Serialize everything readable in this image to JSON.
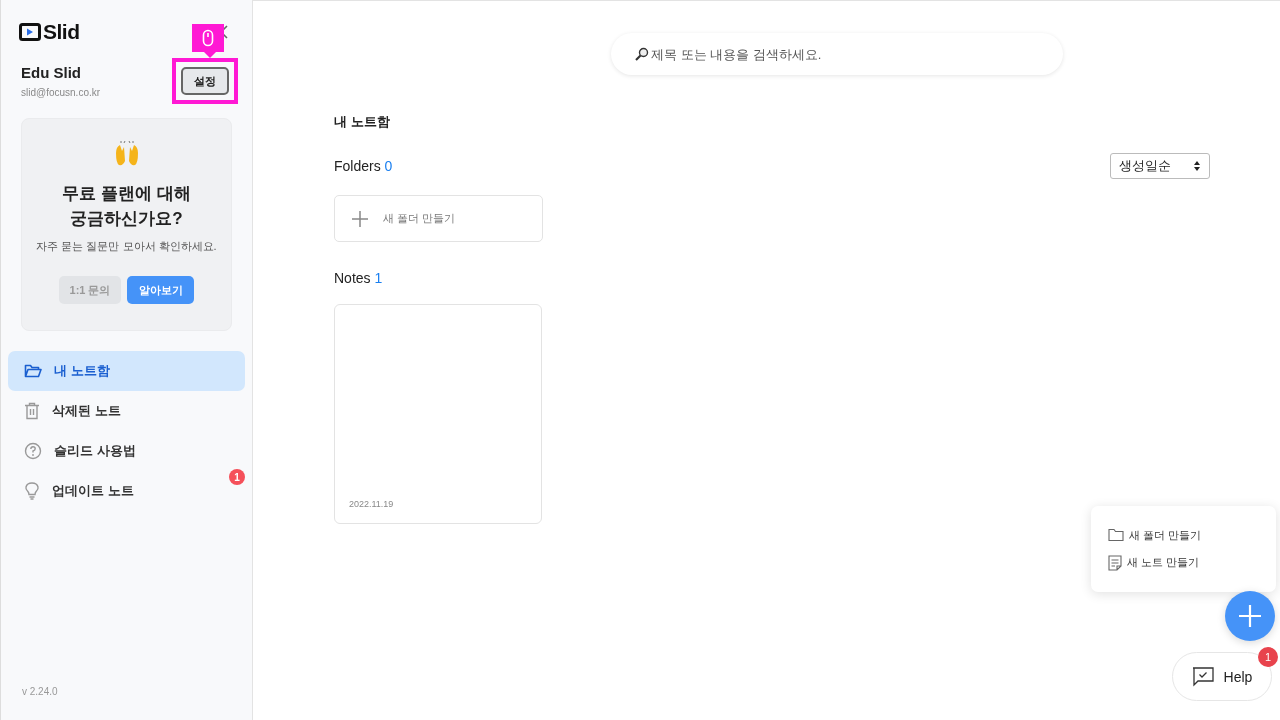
{
  "sidebar": {
    "logo": "Slid",
    "user": {
      "name": "Edu Slid",
      "email": "slid@focusn.co.kr"
    },
    "settings_button": "설정",
    "settings_highlighted": true,
    "promo": {
      "title": "무료 플랜에 대해\n궁금하신가요?",
      "subtitle": "자주 묻는 질문만 모아서 확인하세요.",
      "buttons": [
        {
          "label": "1:1 문의",
          "kind": "secondary"
        },
        {
          "label": "알아보기",
          "kind": "primary"
        }
      ]
    },
    "items": [
      {
        "label": "내 노트함",
        "kind": "folder",
        "selected": true
      },
      {
        "label": "삭제된 노트",
        "kind": "trash",
        "selected": false
      },
      {
        "label": "슬리드 사용법",
        "kind": "help",
        "selected": false
      },
      {
        "label": "업데이트 노트",
        "kind": "bulb",
        "selected": false,
        "badge": "1"
      }
    ],
    "version": "v 2.24.0"
  },
  "search": {
    "placeholder": "제목 또는 내용을 검색하세요."
  },
  "title": "내 노트함",
  "folders": {
    "label": "Folders",
    "count": "0",
    "new_folder": "새 폴더 만들기"
  },
  "sort": {
    "value": "생성일순"
  },
  "notes": {
    "label": "Notes",
    "count": "1",
    "items": [
      {
        "date": "2022.11.19"
      }
    ]
  },
  "fab_menu": [
    {
      "label": "새 폴더 만들기",
      "kind": "folder"
    },
    {
      "label": "새 노트 만들기",
      "kind": "note"
    }
  ],
  "help": {
    "label": "Help",
    "badge": "1"
  }
}
